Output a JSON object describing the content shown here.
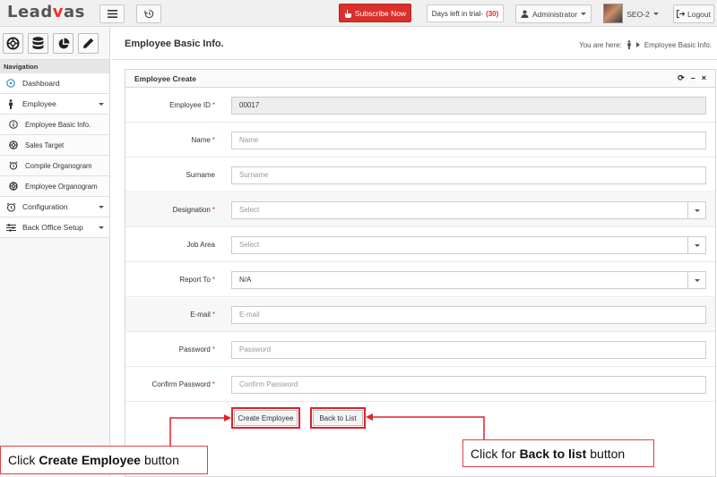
{
  "app": {
    "logo_prefix": "Lead",
    "logo_a": "v",
    "logo_suffix": "as"
  },
  "topbar": {
    "subscribe_label": "Subscribe Now",
    "trial_label": "Days left in trial-",
    "trial_count": "(30)",
    "user_label": "Administrator",
    "account_label": "SEO-2",
    "logout_label": "Logout"
  },
  "sidebar": {
    "nav_title": "Navigation",
    "items": [
      {
        "label": "Dashboard",
        "icon": "dashboard-icon"
      },
      {
        "label": "Employee",
        "icon": "person-icon"
      },
      {
        "label": "Employee Basic Info.",
        "icon": "info-icon"
      },
      {
        "label": "Sales Target",
        "icon": "target-icon"
      },
      {
        "label": "Compile Organogram",
        "icon": "alarm-icon"
      },
      {
        "label": "Employee Organogram",
        "icon": "lifebuoy-icon"
      },
      {
        "label": "Configuration",
        "icon": "clock-icon"
      },
      {
        "label": "Back Office Setup",
        "icon": "sliders-icon"
      }
    ]
  },
  "header": {
    "title": "Employee Basic Info.",
    "breadcrumb_prefix": "You are here:",
    "breadcrumb_page": "Employee Basic Info."
  },
  "panel": {
    "title": "Employee Create",
    "tools": {
      "refresh": "⟳",
      "minimize": "–",
      "close": "×"
    }
  },
  "form": {
    "employee_id": {
      "label": "Employee ID",
      "value": "00017"
    },
    "name": {
      "label": "Name",
      "placeholder": "Name"
    },
    "surname": {
      "label": "Surname",
      "placeholder": "Surname"
    },
    "designation": {
      "label": "Designation",
      "value": "Select"
    },
    "job_area": {
      "label": "Job Area",
      "value": "Select"
    },
    "report_to": {
      "label": "Report To",
      "value": "N/A"
    },
    "email": {
      "label": "E-mail",
      "placeholder": "E-mail"
    },
    "password": {
      "label": "Password",
      "placeholder": "Password"
    },
    "confirm_password": {
      "label": "Confirm Password",
      "placeholder": "Confirm Password"
    },
    "create_button": "Create Employee",
    "back_button": "Back to List"
  },
  "annotations": {
    "create_prefix": "Click",
    "create_bold": "Create Employee",
    "create_suffix": "button",
    "back_prefix": "Click for",
    "back_bold": "Back to list",
    "back_suffix": "button",
    "highlight_color": "#e0202a"
  }
}
